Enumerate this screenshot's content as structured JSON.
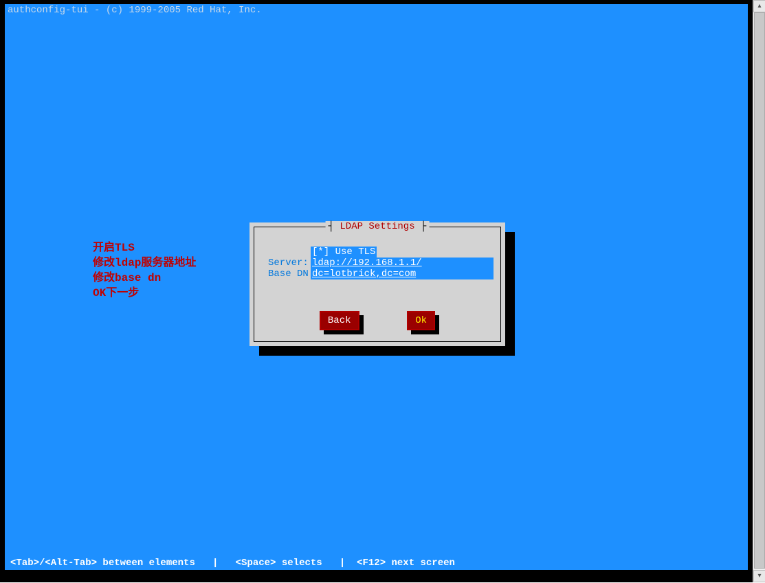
{
  "header": {
    "title": "authconfig-tui - (c) 1999-2005 Red Hat, Inc."
  },
  "annotations": {
    "line1": "开启TLS",
    "line2": "修改ldap服务器地址",
    "line3": "修改base dn",
    "line4": "OK下一步"
  },
  "dialog": {
    "title": "LDAP Settings",
    "use_tls_checkbox": "[*] Use TLS",
    "server_label": "Server:",
    "server_value": "ldap://192.168.1.1/",
    "basedn_label": "Base DN:",
    "basedn_value": "dc=lotbrick,dc=com",
    "back_label": "Back",
    "ok_label": "Ok"
  },
  "footer": {
    "hint": "<Tab>/<Alt-Tab> between elements   |   <Space> selects   |  <F12> next screen"
  }
}
